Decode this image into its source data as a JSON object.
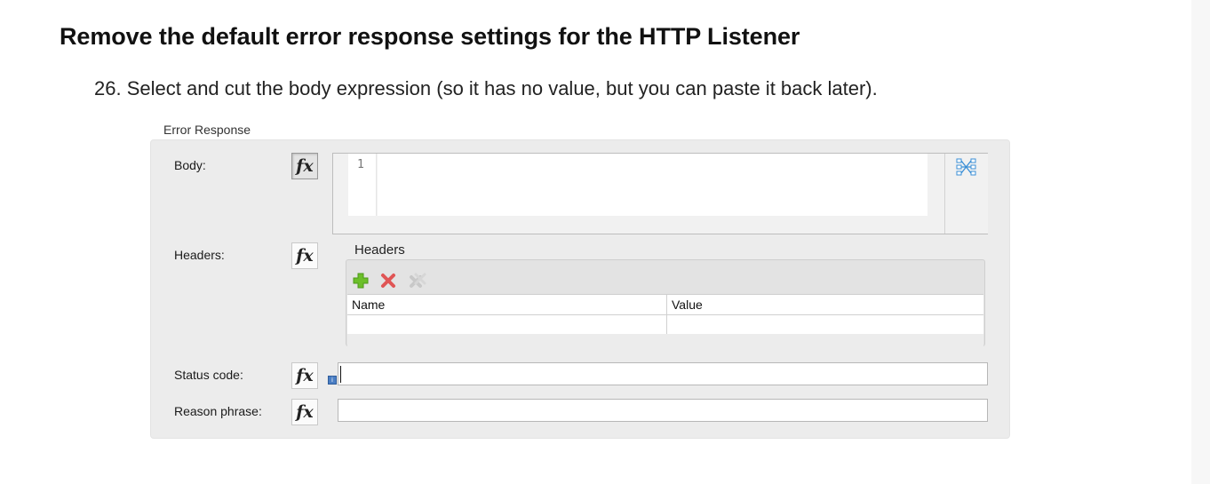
{
  "doc": {
    "heading": "Remove the default error response settings for the HTTP Listener",
    "step": "26. Select and cut the body expression (so it has no value, but you can paste it back later)."
  },
  "error_response": {
    "section_label": "Error Response",
    "body": {
      "label": "Body:",
      "fx_label": "fx",
      "line_number": "1",
      "code": "",
      "mapping_icon": "datamapper-icon"
    },
    "headers": {
      "label": "Headers:",
      "fx_label": "fx",
      "title": "Headers",
      "toolbar_icons": [
        "add-icon",
        "remove-icon",
        "clear-icon"
      ],
      "columns": [
        "Name",
        "Value"
      ],
      "rows": []
    },
    "status_code": {
      "label": "Status code:",
      "fx_label": "fx",
      "value": ""
    },
    "reason_phrase": {
      "label": "Reason phrase:",
      "fx_label": "fx",
      "value": ""
    },
    "colors": {
      "add": "#6cbf2a",
      "remove": "#e05555",
      "clear": "#c8c8c8",
      "hint": "#4a7ec4"
    }
  }
}
